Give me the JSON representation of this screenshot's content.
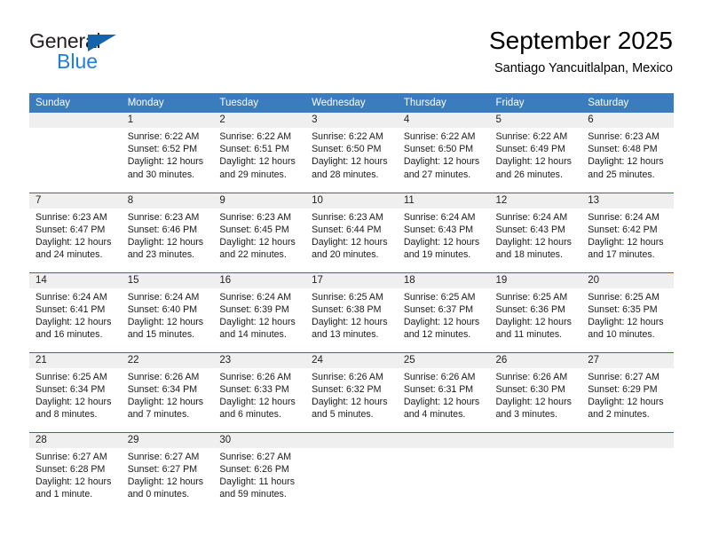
{
  "brand": {
    "name_part1": "General",
    "name_part2": "Blue",
    "triangle_icon": "triangle-icon",
    "accent_color": "#1f7fd6",
    "triangle_color": "#1464ad"
  },
  "header": {
    "title": "September 2025",
    "subtitle": "Santiago Yancuitlalpan, Mexico"
  },
  "theme": {
    "header_row_bg": "#3a7cbd",
    "row_separator": "#2d6ca8",
    "daynum_band_bg": "#efefef",
    "cell_bg": "#ffffff",
    "text_color": "#000000"
  },
  "weekdays": [
    "Sunday",
    "Monday",
    "Tuesday",
    "Wednesday",
    "Thursday",
    "Friday",
    "Saturday"
  ],
  "weeks": [
    [
      {
        "day": "",
        "line1": "",
        "line2": "",
        "line3": "",
        "line4": ""
      },
      {
        "day": "1",
        "line1": "Sunrise: 6:22 AM",
        "line2": "Sunset: 6:52 PM",
        "line3": "Daylight: 12 hours",
        "line4": "and 30 minutes."
      },
      {
        "day": "2",
        "line1": "Sunrise: 6:22 AM",
        "line2": "Sunset: 6:51 PM",
        "line3": "Daylight: 12 hours",
        "line4": "and 29 minutes."
      },
      {
        "day": "3",
        "line1": "Sunrise: 6:22 AM",
        "line2": "Sunset: 6:50 PM",
        "line3": "Daylight: 12 hours",
        "line4": "and 28 minutes."
      },
      {
        "day": "4",
        "line1": "Sunrise: 6:22 AM",
        "line2": "Sunset: 6:50 PM",
        "line3": "Daylight: 12 hours",
        "line4": "and 27 minutes."
      },
      {
        "day": "5",
        "line1": "Sunrise: 6:22 AM",
        "line2": "Sunset: 6:49 PM",
        "line3": "Daylight: 12 hours",
        "line4": "and 26 minutes."
      },
      {
        "day": "6",
        "line1": "Sunrise: 6:23 AM",
        "line2": "Sunset: 6:48 PM",
        "line3": "Daylight: 12 hours",
        "line4": "and 25 minutes."
      }
    ],
    [
      {
        "day": "7",
        "line1": "Sunrise: 6:23 AM",
        "line2": "Sunset: 6:47 PM",
        "line3": "Daylight: 12 hours",
        "line4": "and 24 minutes."
      },
      {
        "day": "8",
        "line1": "Sunrise: 6:23 AM",
        "line2": "Sunset: 6:46 PM",
        "line3": "Daylight: 12 hours",
        "line4": "and 23 minutes."
      },
      {
        "day": "9",
        "line1": "Sunrise: 6:23 AM",
        "line2": "Sunset: 6:45 PM",
        "line3": "Daylight: 12 hours",
        "line4": "and 22 minutes."
      },
      {
        "day": "10",
        "line1": "Sunrise: 6:23 AM",
        "line2": "Sunset: 6:44 PM",
        "line3": "Daylight: 12 hours",
        "line4": "and 20 minutes."
      },
      {
        "day": "11",
        "line1": "Sunrise: 6:24 AM",
        "line2": "Sunset: 6:43 PM",
        "line3": "Daylight: 12 hours",
        "line4": "and 19 minutes."
      },
      {
        "day": "12",
        "line1": "Sunrise: 6:24 AM",
        "line2": "Sunset: 6:43 PM",
        "line3": "Daylight: 12 hours",
        "line4": "and 18 minutes."
      },
      {
        "day": "13",
        "line1": "Sunrise: 6:24 AM",
        "line2": "Sunset: 6:42 PM",
        "line3": "Daylight: 12 hours",
        "line4": "and 17 minutes."
      }
    ],
    [
      {
        "day": "14",
        "line1": "Sunrise: 6:24 AM",
        "line2": "Sunset: 6:41 PM",
        "line3": "Daylight: 12 hours",
        "line4": "and 16 minutes."
      },
      {
        "day": "15",
        "line1": "Sunrise: 6:24 AM",
        "line2": "Sunset: 6:40 PM",
        "line3": "Daylight: 12 hours",
        "line4": "and 15 minutes."
      },
      {
        "day": "16",
        "line1": "Sunrise: 6:24 AM",
        "line2": "Sunset: 6:39 PM",
        "line3": "Daylight: 12 hours",
        "line4": "and 14 minutes."
      },
      {
        "day": "17",
        "line1": "Sunrise: 6:25 AM",
        "line2": "Sunset: 6:38 PM",
        "line3": "Daylight: 12 hours",
        "line4": "and 13 minutes."
      },
      {
        "day": "18",
        "line1": "Sunrise: 6:25 AM",
        "line2": "Sunset: 6:37 PM",
        "line3": "Daylight: 12 hours",
        "line4": "and 12 minutes."
      },
      {
        "day": "19",
        "line1": "Sunrise: 6:25 AM",
        "line2": "Sunset: 6:36 PM",
        "line3": "Daylight: 12 hours",
        "line4": "and 11 minutes."
      },
      {
        "day": "20",
        "line1": "Sunrise: 6:25 AM",
        "line2": "Sunset: 6:35 PM",
        "line3": "Daylight: 12 hours",
        "line4": "and 10 minutes."
      }
    ],
    [
      {
        "day": "21",
        "line1": "Sunrise: 6:25 AM",
        "line2": "Sunset: 6:34 PM",
        "line3": "Daylight: 12 hours",
        "line4": "and 8 minutes."
      },
      {
        "day": "22",
        "line1": "Sunrise: 6:26 AM",
        "line2": "Sunset: 6:34 PM",
        "line3": "Daylight: 12 hours",
        "line4": "and 7 minutes."
      },
      {
        "day": "23",
        "line1": "Sunrise: 6:26 AM",
        "line2": "Sunset: 6:33 PM",
        "line3": "Daylight: 12 hours",
        "line4": "and 6 minutes."
      },
      {
        "day": "24",
        "line1": "Sunrise: 6:26 AM",
        "line2": "Sunset: 6:32 PM",
        "line3": "Daylight: 12 hours",
        "line4": "and 5 minutes."
      },
      {
        "day": "25",
        "line1": "Sunrise: 6:26 AM",
        "line2": "Sunset: 6:31 PM",
        "line3": "Daylight: 12 hours",
        "line4": "and 4 minutes."
      },
      {
        "day": "26",
        "line1": "Sunrise: 6:26 AM",
        "line2": "Sunset: 6:30 PM",
        "line3": "Daylight: 12 hours",
        "line4": "and 3 minutes."
      },
      {
        "day": "27",
        "line1": "Sunrise: 6:27 AM",
        "line2": "Sunset: 6:29 PM",
        "line3": "Daylight: 12 hours",
        "line4": "and 2 minutes."
      }
    ],
    [
      {
        "day": "28",
        "line1": "Sunrise: 6:27 AM",
        "line2": "Sunset: 6:28 PM",
        "line3": "Daylight: 12 hours",
        "line4": "and 1 minute."
      },
      {
        "day": "29",
        "line1": "Sunrise: 6:27 AM",
        "line2": "Sunset: 6:27 PM",
        "line3": "Daylight: 12 hours",
        "line4": "and 0 minutes."
      },
      {
        "day": "30",
        "line1": "Sunrise: 6:27 AM",
        "line2": "Sunset: 6:26 PM",
        "line3": "Daylight: 11 hours",
        "line4": "and 59 minutes."
      },
      {
        "day": "",
        "line1": "",
        "line2": "",
        "line3": "",
        "line4": ""
      },
      {
        "day": "",
        "line1": "",
        "line2": "",
        "line3": "",
        "line4": ""
      },
      {
        "day": "",
        "line1": "",
        "line2": "",
        "line3": "",
        "line4": ""
      },
      {
        "day": "",
        "line1": "",
        "line2": "",
        "line3": "",
        "line4": ""
      }
    ]
  ]
}
